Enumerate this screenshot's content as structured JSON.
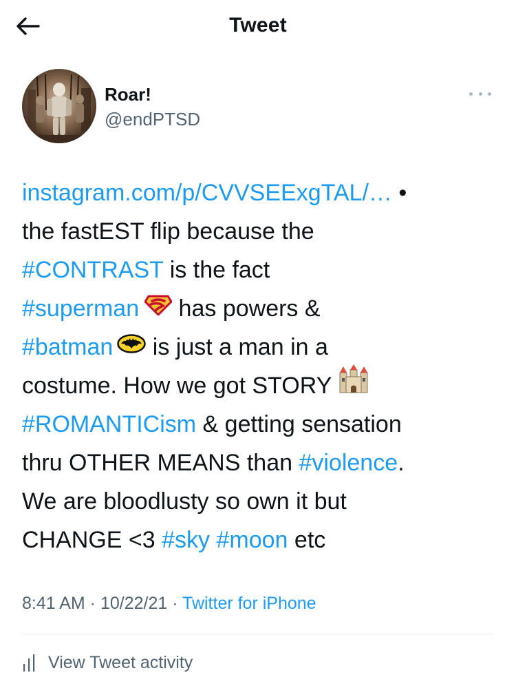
{
  "header": {
    "title": "Tweet",
    "back_icon": "arrow-left-icon"
  },
  "author": {
    "display_name": "Roar!",
    "handle": "@endPTSD",
    "avatar_icon": "avatar-photo-armor",
    "more_icon": "more-horizontal-icon"
  },
  "tweet": {
    "link": "instagram.com/p/CVVSEExgTAL/…",
    "bullet": " •",
    "t1": "the fastEST flip because the",
    "tag_contrast": "#CONTRAST",
    "t2": " is the fact",
    "tag_superman": "#superman",
    "t3": " has powers &",
    "tag_batman": "#batman",
    "t4": " is just a man in a",
    "t5": "costume. How we got STORY ",
    "tag_romanticism": "#ROMANTICism",
    "t6": " & getting sensation",
    "t7": "thru OTHER MEANS than ",
    "tag_violence": "#violence",
    "t8": ".",
    "t9": "We are bloodlusty so own it but",
    "t10": "CHANGE <3 ",
    "tag_sky": "#sky",
    "tag_moon": "#moon",
    "t11": " etc",
    "emojis": [
      "superman-emblem-emoji",
      "batman-emblem-emoji",
      "castle-emoji"
    ]
  },
  "meta": {
    "time": "8:41 AM",
    "sep1": " · ",
    "date": "10/22/21",
    "sep2": " · ",
    "source": "Twitter for iPhone"
  },
  "activity": {
    "label": "View Tweet activity",
    "icon": "bar-chart-icon"
  },
  "colors": {
    "link": "#1d9bf0",
    "text": "#0f1419",
    "secondary": "#536471",
    "divider": "#e7ecf0"
  }
}
